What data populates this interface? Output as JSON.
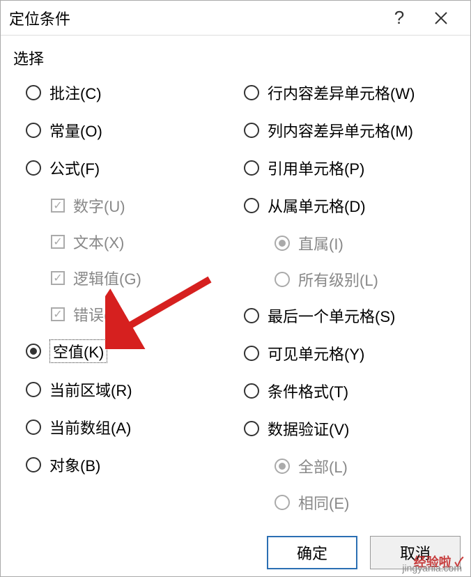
{
  "dialog": {
    "title": "定位条件",
    "help": "?",
    "section": "选择"
  },
  "left": {
    "comment": "批注(C)",
    "constant": "常量(O)",
    "formula": "公式(F)",
    "numbers": "数字(U)",
    "text": "文本(X)",
    "logical": "逻辑值(G)",
    "errors": "错误(E)",
    "blanks": "空值(K)",
    "current_region": "当前区域(R)",
    "current_array": "当前数组(A)",
    "objects": "对象(B)"
  },
  "right": {
    "row_diff": "行内容差异单元格(W)",
    "col_diff": "列内容差异单元格(M)",
    "precedents": "引用单元格(P)",
    "dependents": "从属单元格(D)",
    "direct": "直属(I)",
    "all_levels": "所有级别(L)",
    "last_cell": "最后一个单元格(S)",
    "visible": "可见单元格(Y)",
    "cond_format": "条件格式(T)",
    "data_valid": "数据验证(V)",
    "all": "全部(L)",
    "same": "相同(E)"
  },
  "buttons": {
    "ok": "确定",
    "cancel": "取消"
  },
  "watermark": "经验啦 ✓",
  "watermark2": "jingyanla.com"
}
